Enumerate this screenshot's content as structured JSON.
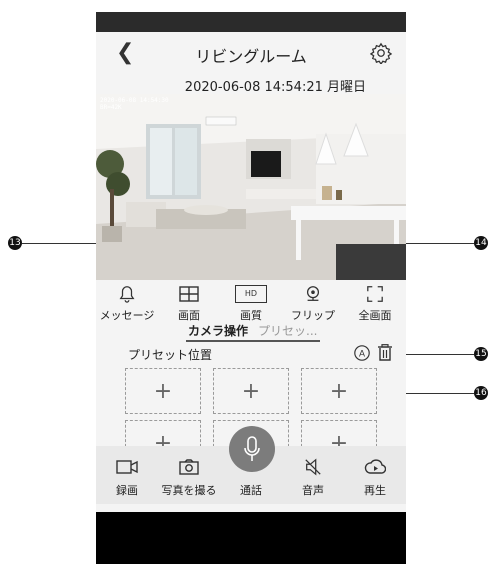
{
  "header": {
    "title": "リビングルーム"
  },
  "datetime": "2020-06-08 14:54:21 月曜日",
  "video": {
    "osd_line1": "2020-06-08 14:54:30",
    "osd_line2": "BR=42K"
  },
  "toolbar": [
    {
      "label": "メッセージ",
      "icon": "bell-icon"
    },
    {
      "label": "画面",
      "icon": "split-screen-icon"
    },
    {
      "label": "画質",
      "icon": "hd-icon",
      "badge": "HD"
    },
    {
      "label": "フリップ",
      "icon": "webcam-icon"
    },
    {
      "label": "全画面",
      "icon": "fullscreen-icon"
    }
  ],
  "tabs": {
    "camera": "カメラ操作",
    "preset": "プリセッ..."
  },
  "preset": {
    "label": "プリセット位置",
    "slots": [
      "+",
      "+",
      "+",
      "+",
      "+",
      "+"
    ]
  },
  "bottombar": [
    {
      "label": "録画",
      "icon": "video-record-icon"
    },
    {
      "label": "写真を撮る",
      "icon": "camera-icon"
    },
    {
      "label": "通話",
      "icon": "microphone-icon"
    },
    {
      "label": "音声",
      "icon": "speaker-mute-icon"
    },
    {
      "label": "再生",
      "icon": "playback-icon"
    }
  ],
  "callouts": {
    "c13": "13",
    "c14": "14",
    "c15": "15",
    "c16": "16"
  }
}
